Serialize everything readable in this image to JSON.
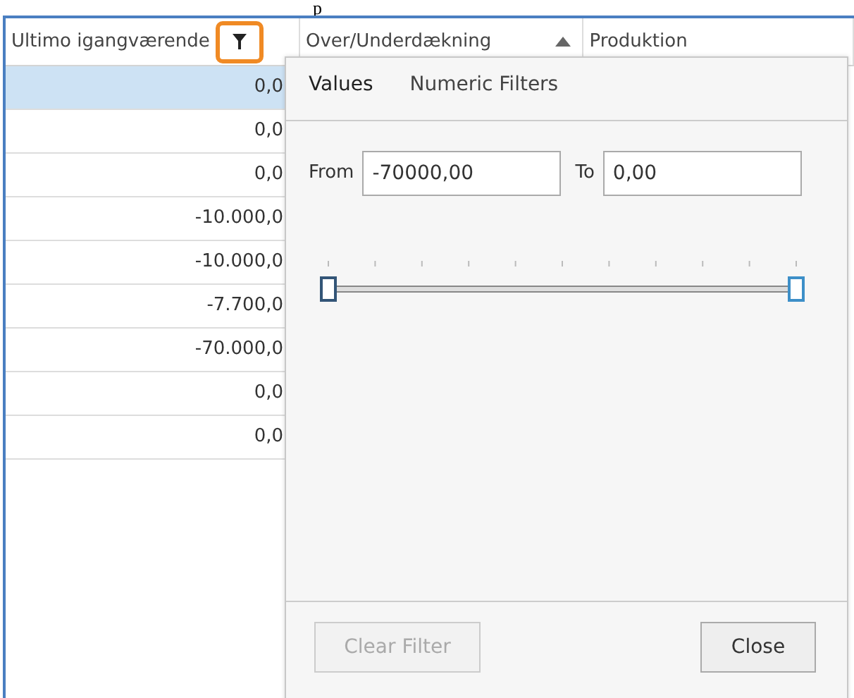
{
  "caption_fragment": "p",
  "grid": {
    "columns": [
      {
        "label": "Ultimo igangværende",
        "filter_active": true,
        "sorted": false
      },
      {
        "label": "Over/Underdækning",
        "filter_active": false,
        "sorted": true
      },
      {
        "label": "Produktion",
        "filter_active": false,
        "sorted": false
      }
    ],
    "rows": [
      {
        "value": "0,0",
        "selected": true
      },
      {
        "value": "0,0",
        "selected": false
      },
      {
        "value": "0,0",
        "selected": false
      },
      {
        "value": "-10.000,0",
        "selected": false
      },
      {
        "value": "-10.000,0",
        "selected": false
      },
      {
        "value": "-7.700,0",
        "selected": false
      },
      {
        "value": "-70.000,0",
        "selected": false
      },
      {
        "value": "0,0",
        "selected": false
      },
      {
        "value": "0,0",
        "selected": false
      }
    ]
  },
  "filter_popup": {
    "tabs": [
      {
        "label": "Values",
        "selected": true
      },
      {
        "label": "Numeric Filters",
        "selected": false
      }
    ],
    "from": {
      "label": "From",
      "value": "-70000,00"
    },
    "to": {
      "label": "To",
      "value": "0,00"
    },
    "slider": {
      "thumbs": [
        {
          "level": 0
        },
        {
          "level": 1
        }
      ]
    },
    "buttons": [
      {
        "label": "Clear Filter",
        "disabled": true
      },
      {
        "label": "Close",
        "disabled": false
      }
    ]
  }
}
